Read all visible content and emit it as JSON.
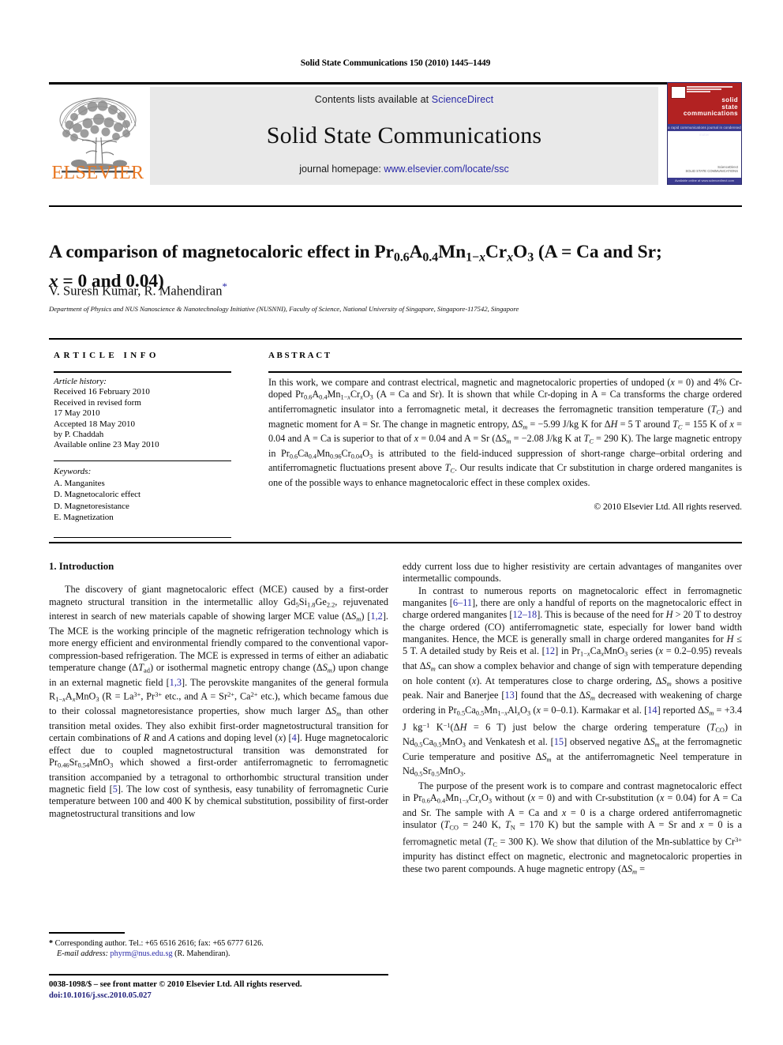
{
  "running_head": "Solid State Communications 150 (2010) 1445–1449",
  "header": {
    "contents_prefix": "Contents lists available at ",
    "sciencedirect": "ScienceDirect",
    "journal_title": "Solid State Communications",
    "homepage_prefix": "journal homepage: ",
    "homepage_url": "www.elsevier.com/locate/ssc",
    "publisher_wordmark": "ELSEVIER",
    "accent_orange": "#E87722",
    "link_blue": "#2a2aa8",
    "band_gray": "#e9e9e9"
  },
  "cover": {
    "line1": "solid",
    "line2": "state",
    "line3": "communications",
    "band_text": "a rapid communications journal in condensed matter",
    "foot1": "ScienceDirect",
    "foot2": "SOLID STATE COMMUNICATIONS",
    "bottom_band": "Available online at www.sciencedirect.com",
    "red": "#b22222",
    "blue": "#3b3b8f"
  },
  "article": {
    "title_line1": "A comparison of magnetocaloric effect in Pr<sub>0.6</sub>A<sub>0.4</sub>Mn<sub>1−<i>x</i></sub>Cr<sub><i>x</i></sub>O<sub>3</sub> (A = Ca and Sr;",
    "title_line2": "<i>x</i> = 0 and 0.04)",
    "authors": "V. Suresh Kumar, R. Mahendiran",
    "author_marker": "*",
    "affiliation": "Department of Physics and NUS Nanoscience & Nanotechnology Initiative (NUSNNI), Faculty of Science, National University of Singapore, Singapore-117542, Singapore"
  },
  "info": {
    "heading": "ARTICLE INFO",
    "history_label": "Article history:",
    "history": [
      "Received 16 February 2010",
      "Received in revised form",
      "17 May 2010",
      "Accepted 18 May 2010",
      "by P. Chaddah",
      "Available online 23 May 2010"
    ],
    "keywords_label": "Keywords:",
    "keywords": [
      "A. Manganites",
      "D. Magnetocaloric effect",
      "D. Magnetoresistance",
      "E. Magnetization"
    ]
  },
  "abstract": {
    "heading": "ABSTRACT",
    "html": "In this work, we compare and contrast electrical, magnetic and magnetocaloric properties of undoped (<i>x</i> = 0) and 4% Cr-doped Pr<sub>0.6</sub>A<sub>0.4</sub>Mn<sub>1−<i>x</i></sub>Cr<sub><i>x</i></sub>O<sub>3</sub> (A = Ca and Sr). It is shown that while Cr-doping in A = Ca transforms the charge ordered antiferromagnetic insulator into a ferromagnetic metal, it decreases the ferromagnetic transition temperature (<i>T<sub>C</sub></i>) and magnetic moment for A = Sr. The change in magnetic entropy, Δ<i>S<sub>m</sub></i> = −5.99 J/kg K for Δ<i>H</i> = 5 T around <i>T<sub>C</sub></i> = 155 K of <i>x</i> = 0.04 and A = Ca is superior to that of <i>x</i> = 0.04 and A = Sr (Δ<i>S<sub>m</sub></i> = −2.08 J/kg K at <i>T<sub>C</sub></i> = 290 K). The large magnetic entropy in Pr<sub>0.6</sub>Ca<sub>0.4</sub>Mn<sub>0.96</sub>Cr<sub>0.04</sub>O<sub>3</sub> is attributed to the field-induced suppression of short-range charge–orbital ordering and antiferromagnetic fluctuations present above <i>T<sub>C</sub></i>. Our results indicate that Cr substitution in charge ordered manganites is one of the possible ways to enhance magnetocaloric effect in these complex oxides.",
    "copyright": "© 2010 Elsevier Ltd. All rights reserved."
  },
  "body": {
    "section_heading": "1. Introduction",
    "left_paragraphs": [
      "The discovery of giant magnetocaloric effect (MCE) caused by a first-order magneto structural transition in the intermetallic alloy Gd<sub>5</sub>Si<sub>1.8</sub>Ge<sub>2.2</sub>, rejuvenated interest in search of new materials capable of showing larger MCE value (Δ<i>S<sub>m</sub></i>) [<span class=\"ref\">1,2</span>]. The MCE is the working principle of the magnetic refrigeration technology which is more energy efficient and environmental friendly compared to the conventional vapor-compression-based refrigeration. The MCE is expressed in terms of either an adiabatic temperature change (Δ<i>T</i><sub>ad</sub>) or isothermal magnetic entropy change (Δ<i>S<sub>m</sub></i>) upon change in an external magnetic field [<span class=\"ref\">1,3</span>]. The perovskite manganites of the general formula R<sub>1−<i>x</i></sub>A<sub><i>x</i></sub>MnO<sub>3</sub> (R = La<sup>3+</sup>, Pr<sup>3+</sup> etc., and A = Sr<sup>2+</sup>, Ca<sup>2+</sup> etc.), which became famous due to their colossal magnetoresistance properties, show much larger Δ<i>S<sub>m</sub></i> than other transition metal oxides. They also exhibit first-order magnetostructural transition for certain combinations of <i>R</i> and <i>A</i> cations and doping level (<i>x</i>) [<span class=\"ref\">4</span>]. Huge magnetocaloric effect due to coupled magnetostructural transition was demonstrated for Pr<sub>0.46</sub>Sr<sub>0.54</sub>MnO<sub>3</sub> which showed a first-order antiferromagnetic to ferromagnetic transition accompanied by a tetragonal to orthorhombic structural transition under magnetic field [<span class=\"ref\">5</span>]. The low cost of synthesis, easy tunability of ferromagnetic Curie temperature between 100 and 400 K by chemical substitution, possibility of first-order magnetostructural transitions and low"
    ],
    "right_paragraphs": [
      "eddy current loss due to higher resistivity are certain advantages of manganites over intermetallic compounds.",
      "In contrast to numerous reports on magnetocaloric effect in ferromagnetic manganites [<span class=\"ref\">6–11</span>], there are only a handful of reports on the magnetocaloric effect in charge ordered manganites [<span class=\"ref\">12–18</span>]. This is because of the need for <i>H</i> > 20 T to destroy the charge ordered (CO) antiferromagnetic state, especially for lower band width manganites. Hence, the MCE is generally small in charge ordered manganites for <i>H</i> ≤ 5 T. A detailed study by Reis et al. [<span class=\"ref\">12</span>] in Pr<sub>1−<i>x</i></sub>Ca<sub><i>x</i></sub>MnO<sub>3</sub> series (<i>x</i> = 0.2–0.95) reveals that Δ<i>S<sub>m</sub></i> can show a complex behavior and change of sign with temperature depending on hole content (<i>x</i>). At temperatures close to charge ordering, Δ<i>S<sub>m</sub></i> shows a positive peak. Nair and Banerjee [<span class=\"ref\">13</span>] found that the Δ<i>S<sub>m</sub></i> decreased with weakening of charge ordering in Pr<sub>0.5</sub>Ca<sub>0.5</sub>Mn<sub>1−<i>x</i></sub>Al<sub><i>x</i></sub>O<sub>3</sub> (<i>x</i> = 0–0.1). Karmakar et al. [<span class=\"ref\">14</span>] reported Δ<i>S<sub>m</sub></i> = +3.4 J kg<sup>−1</sup> K<sup>−1</sup>(Δ<i>H</i> = 6 T) just below the charge ordering temperature (<i>T</i><sub>CO</sub>) in Nd<sub>0.5</sub>Ca<sub>0.5</sub>MnO<sub>3</sub> and Venkatesh et al. [<span class=\"ref\">15</span>] observed negative Δ<i>S<sub>m</sub></i> at the ferromagnetic Curie temperature and positive Δ<i>S<sub>m</sub></i> at the antiferromagnetic Neel temperature in Nd<sub>0.5</sub>Sr<sub>0.5</sub>MnO<sub>3</sub>.",
      "The purpose of the present work is to compare and contrast magnetocaloric effect in Pr<sub>0.6</sub>A<sub>0.4</sub>Mn<sub>1−<i>x</i></sub>Cr<sub><i>x</i></sub>O<sub>3</sub> without (<i>x</i> = 0) and with Cr-substitution (<i>x</i> = 0.04) for A = Ca and Sr. The sample with A = Ca and <i>x</i> = 0 is a charge ordered antiferromagnetic insulator (<i>T</i><sub>CO</sub> = 240 K, <i>T</i><sub>N</sub> = 170 K) but the sample with A = Sr and <i>x</i> = 0 is a ferromagnetic metal (<i>T</i><sub>C</sub> = 300 K). We show that dilution of the Mn-sublattice by Cr<sup>3+</sup> impurity has distinct effect on magnetic, electronic and magnetocaloric properties in these two parent compounds. A huge magnetic entropy (Δ<i>S<sub>m</sub></i> ="
    ]
  },
  "footnote": {
    "marker": "*",
    "line1": "Corresponding author. Tel.: +65 6516 2616; fax: +65 6777 6126.",
    "email_label": "E-mail address:",
    "email": "phyrm@nus.edu.sg",
    "email_owner": "(R. Mahendiran)."
  },
  "page_footer": {
    "issn_line": "0038-1098/$ – see front matter © 2010 Elsevier Ltd. All rights reserved.",
    "doi": "doi:10.1016/j.ssc.2010.05.027"
  }
}
